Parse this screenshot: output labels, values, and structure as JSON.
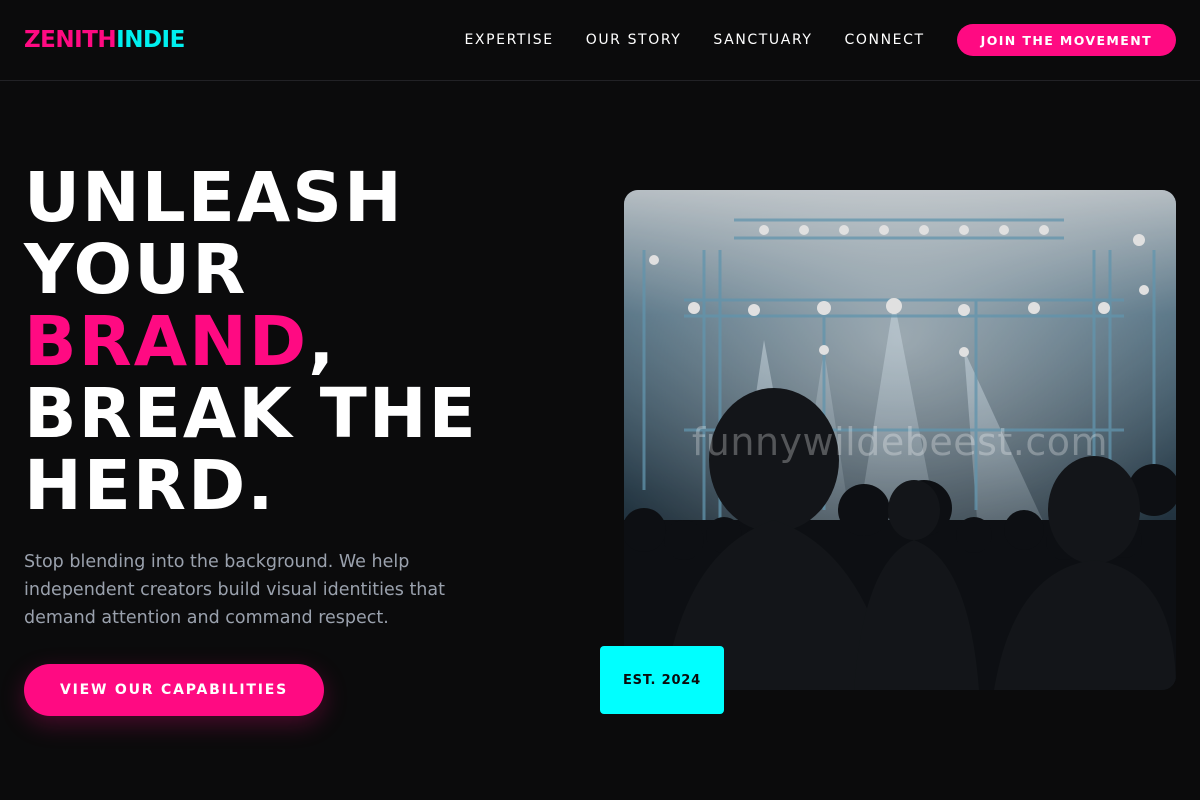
{
  "brand": {
    "part1": "ZENITH",
    "part2": "INDIE"
  },
  "nav": {
    "links": [
      "EXPERTISE",
      "OUR STORY",
      "SANCTUARY",
      "CONNECT"
    ],
    "cta": "JOIN THE MOVEMENT"
  },
  "hero": {
    "line1": "UNLEASH",
    "line2": "YOUR",
    "line3_highlight": "BRAND",
    "line3_rest": ",",
    "line4": "BREAK THE",
    "line5": "HERD.",
    "description": "Stop blending into the background. We help independent creators build visual identities that demand attention and command respect.",
    "button": "VIEW OUR CAPABILITIES"
  },
  "image": {
    "watermark": "funnywildebeest.com",
    "badge": "EST. 2024"
  },
  "colors": {
    "accent": "#ff0a82",
    "secondary": "#00f0f0",
    "background": "#0b0b0c"
  }
}
